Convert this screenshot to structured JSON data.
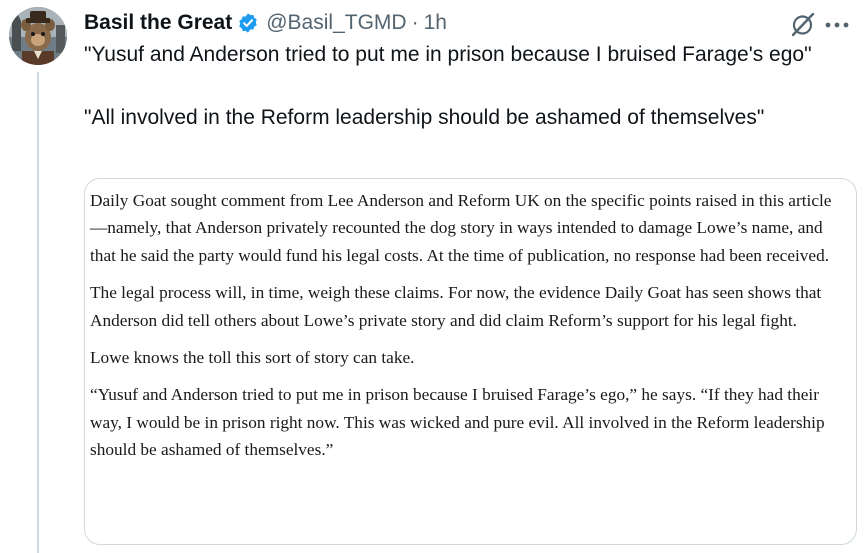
{
  "author": {
    "display_name": "Basil the Great",
    "handle": "@Basil_TGMD",
    "separator": "·",
    "timestamp": "1h",
    "verified_color": "#1d9bf0"
  },
  "icons": {
    "avatar": "avatar-icon",
    "verified": "verified-badge-icon",
    "grok": "grok-icon",
    "more": "more-icon"
  },
  "tweet": {
    "paragraphs": [
      "\"Yusuf and Anderson tried to put me in prison because I bruised Farage's ego\"",
      "\"All involved in the Reform leadership should be ashamed of themselves\""
    ]
  },
  "article_excerpt": {
    "paragraphs": [
      "Daily Goat sought comment from Lee Anderson and Reform UK on the specific points raised in this article—namely, that Anderson privately recounted the dog story in ways intended to damage Lowe’s name, and that he said the party would fund his legal costs. At the time of publication, no response had been received.",
      "The legal process will, in time, weigh these claims. For now, the evidence Daily Goat has seen shows that Anderson did tell others about Lowe’s private story and did claim Reform’s support for his legal fight.",
      "Lowe knows the toll this sort of story can take.",
      "“Yusuf and Anderson tried to put me in prison because I bruised Farage’s ego,” he says. “If they had their way, I would be in prison right now. This was wicked and pure evil. All involved in the Reform leadership should be ashamed of themselves.”"
    ]
  }
}
